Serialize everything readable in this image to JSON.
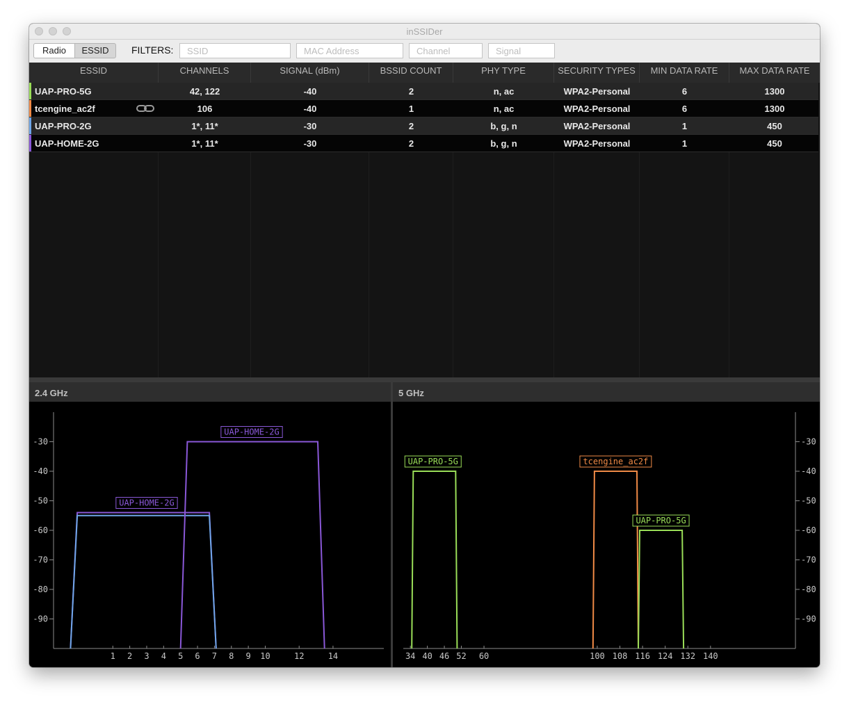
{
  "window": {
    "title": "inSSIDer"
  },
  "toolbar": {
    "view_modes": [
      "Radio",
      "ESSID"
    ],
    "active_mode": "ESSID",
    "filters_label": "FILTERS:",
    "filter_placeholders": {
      "ssid": "SSID",
      "mac": "MAC Address",
      "channel": "Channel",
      "signal": "Signal"
    }
  },
  "table": {
    "columns": [
      "ESSID",
      "CHANNELS",
      "SIGNAL (dBm)",
      "BSSID COUNT",
      "PHY TYPE",
      "SECURITY TYPES",
      "MIN DATA RATE",
      "MAX DATA RATE"
    ],
    "rows": [
      {
        "essid": "UAP-PRO-5G",
        "channels": "42, 122",
        "signal": "-40",
        "bssid_count": "2",
        "phy": "n, ac",
        "security": "WPA2-Personal",
        "min_rate": "6",
        "max_rate": "1300",
        "color": "#9ade58",
        "linked": false
      },
      {
        "essid": "tcengine_ac2f",
        "channels": "106",
        "signal": "-40",
        "bssid_count": "1",
        "phy": "n, ac",
        "security": "WPA2-Personal",
        "min_rate": "6",
        "max_rate": "1300",
        "color": "#f08a46",
        "linked": true
      },
      {
        "essid": "UAP-PRO-2G",
        "channels": "1*, 11*",
        "signal": "-30",
        "bssid_count": "2",
        "phy": "b, g, n",
        "security": "WPA2-Personal",
        "min_rate": "1",
        "max_rate": "450",
        "color": "#6fa6e8",
        "linked": false
      },
      {
        "essid": "UAP-HOME-2G",
        "channels": "1*, 11*",
        "signal": "-30",
        "bssid_count": "2",
        "phy": "b, g, n",
        "security": "WPA2-Personal",
        "min_rate": "1",
        "max_rate": "450",
        "color": "#8a58d8",
        "linked": false
      }
    ]
  },
  "chart_data": [
    {
      "type": "line",
      "title": "2.4 GHz",
      "x_ticks": [
        1,
        2,
        3,
        4,
        5,
        6,
        7,
        8,
        9,
        10,
        12,
        14
      ],
      "y_ticks": [
        -30,
        -40,
        -50,
        -60,
        -70,
        -80,
        -90
      ],
      "ylim": [
        -100,
        -20
      ],
      "xlim": [
        -2.5,
        17
      ],
      "series": [
        {
          "name": "UAP-HOME-2G",
          "color": "#8a58d8",
          "x": [
            -1.5,
            -1.1,
            6.7,
            7.1
          ],
          "y": [
            -100,
            -54,
            -54,
            -100
          ],
          "label_x": 3
        },
        {
          "name": "UAP-PRO-2G",
          "color": "#6fa6e8",
          "x": [
            -1.5,
            -1.1,
            6.7,
            7.1
          ],
          "y": [
            -100,
            -55,
            -55,
            -100
          ]
        },
        {
          "name": "UAP-HOME-2G",
          "color": "#8a58d8",
          "x": [
            5,
            5.4,
            13.1,
            13.5
          ],
          "y": [
            -100,
            -30,
            -30,
            -100
          ],
          "label_x": 9.2
        }
      ]
    },
    {
      "type": "line",
      "title": "5 GHz",
      "x_ticks": [
        34,
        40,
        46,
        52,
        60,
        100,
        108,
        116,
        124,
        132,
        140
      ],
      "y_ticks": [
        -30,
        -40,
        -50,
        -60,
        -70,
        -80,
        -90
      ],
      "ylim": [
        -100,
        -20
      ],
      "xlim": [
        31.5,
        170
      ],
      "series": [
        {
          "name": "UAP-PRO-5G",
          "color": "#9ade58",
          "x": [
            34.5,
            35,
            50,
            50.5
          ],
          "y": [
            -100,
            -40,
            -40,
            -100
          ],
          "label_x": 42
        },
        {
          "name": "tcengine_ac2f",
          "color": "#f08a46",
          "x": [
            98.5,
            99,
            114,
            114.5
          ],
          "y": [
            -100,
            -40,
            -40,
            -100
          ],
          "label_x": 106.5
        },
        {
          "name": "UAP-PRO-5G",
          "color": "#9ade58",
          "x": [
            114.5,
            115,
            130,
            130.5
          ],
          "y": [
            -100,
            -60,
            -60,
            -100
          ],
          "label_x": 122.5
        }
      ]
    }
  ]
}
